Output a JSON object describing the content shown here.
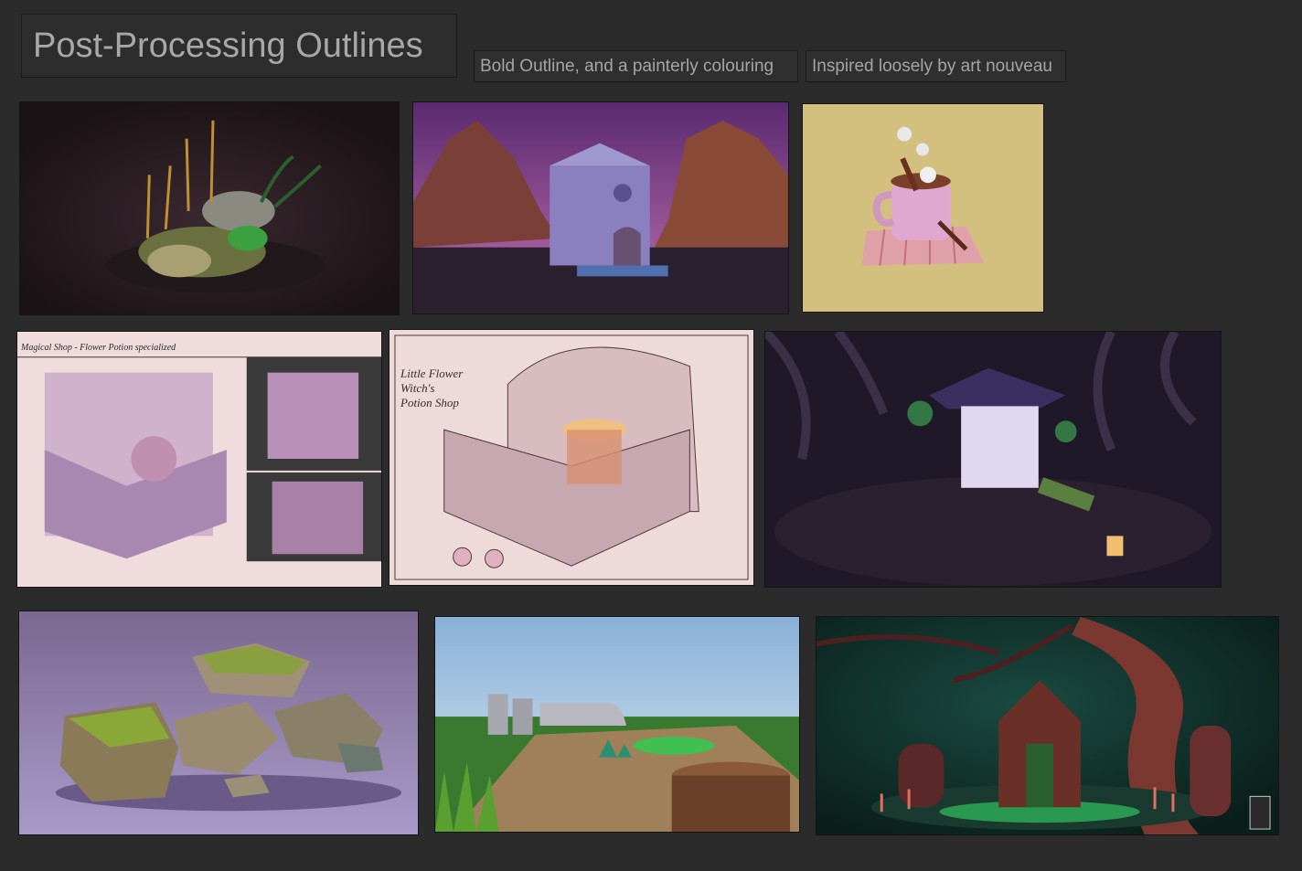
{
  "board": {
    "title": "Post-Processing Outlines",
    "tags": [
      "Bold Outline, and a painterly colouring",
      "Inspired loosely by art nouveau"
    ]
  },
  "images": [
    {
      "name": "plants-on-rocks-render"
    },
    {
      "name": "purple-mountain-chapel-render"
    },
    {
      "name": "hot-chocolate-mug-render"
    },
    {
      "name": "magical-shop-concept-sheet",
      "caption": "Magical Shop - Flower Potion specialized"
    },
    {
      "name": "potion-shop-sketch",
      "caption": "Little Flower Witch's Potion Shop"
    },
    {
      "name": "night-forest-lantern-shrine-render"
    },
    {
      "name": "mossy-rocks-render"
    },
    {
      "name": "grassy-graveyard-render"
    },
    {
      "name": "green-crypt-tree-render"
    }
  ]
}
